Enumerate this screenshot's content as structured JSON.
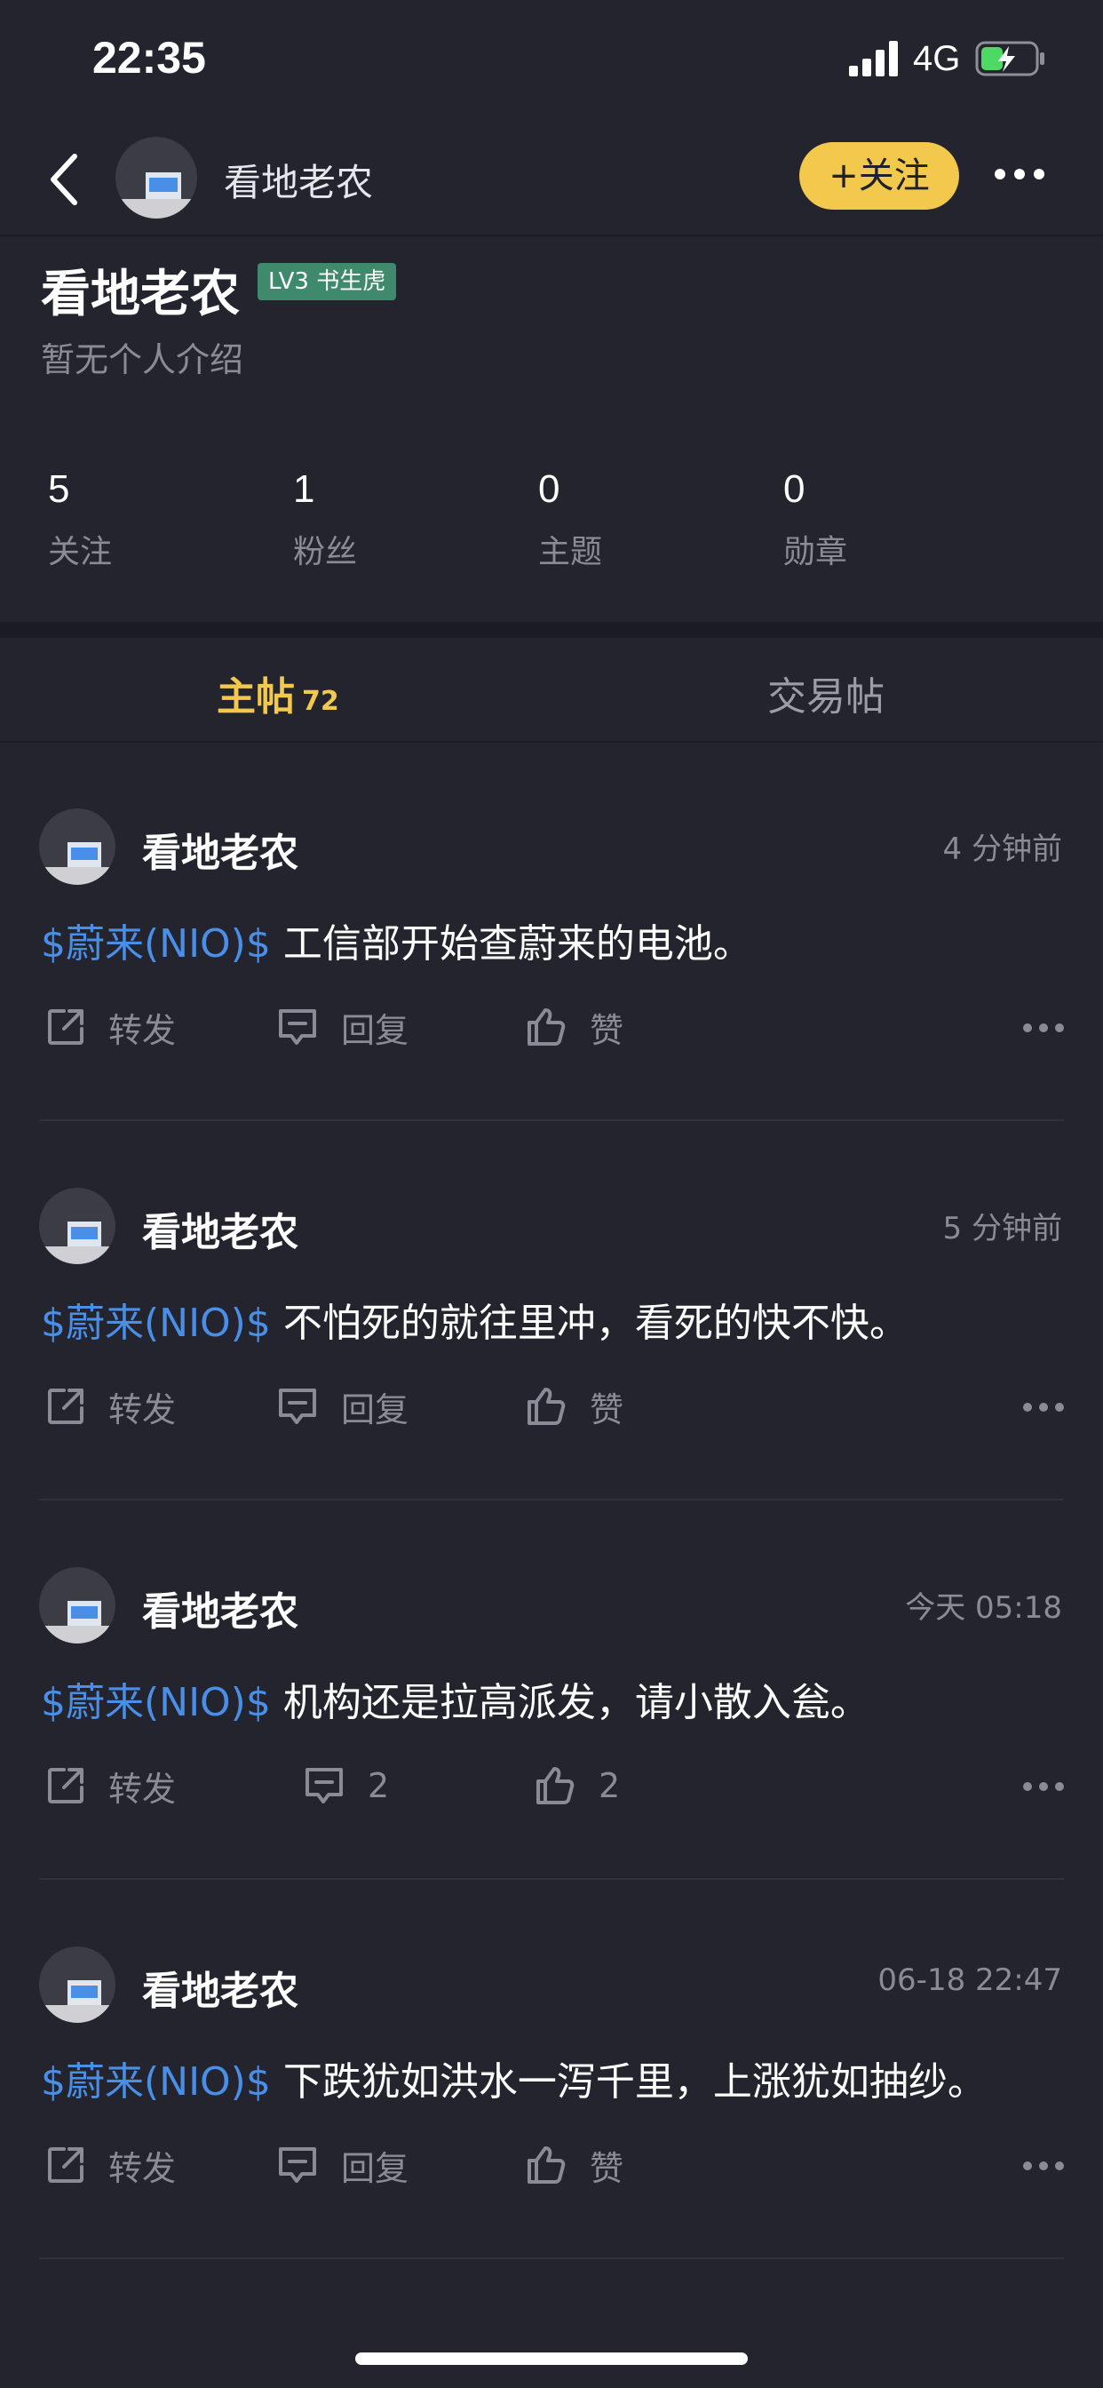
{
  "status_bar": {
    "time": "22:35",
    "network": "4G",
    "signal_icon": "signal-bars-icon",
    "battery_icon": "battery-charging-icon"
  },
  "nav": {
    "back_icon": "chevron-left-icon",
    "user_name": "看地老农",
    "follow_label": "+关注",
    "more_icon": "ellipsis-icon"
  },
  "profile": {
    "name": "看地老农",
    "level_badge": "LV3 书生虎",
    "bio": "暂无个人介绍",
    "stats": [
      {
        "value": "5",
        "label": "关注"
      },
      {
        "value": "1",
        "label": "粉丝"
      },
      {
        "value": "0",
        "label": "主题"
      },
      {
        "value": "0",
        "label": "勋章"
      }
    ]
  },
  "tabs": {
    "main_label": "主帖",
    "main_count": "72",
    "trade_label": "交易帖"
  },
  "posts": [
    {
      "author": "看地老农",
      "time": "4 分钟前",
      "stock_tag": "$蔚来(NIO)$",
      "text": "工信部开始查蔚来的电池。",
      "forward_label": "转发",
      "reply_label": "回复",
      "like_label": "赞"
    },
    {
      "author": "看地老农",
      "time": "5 分钟前",
      "stock_tag": "$蔚来(NIO)$",
      "text": "不怕死的就往里冲，看死的快不快。",
      "forward_label": "转发",
      "reply_label": "回复",
      "like_label": "赞"
    },
    {
      "author": "看地老农",
      "time": "今天 05:18",
      "stock_tag": "$蔚来(NIO)$",
      "text": "机构还是拉高派发，请小散入瓮。",
      "forward_label": "转发",
      "reply_label": "2",
      "like_label": "2"
    },
    {
      "author": "看地老农",
      "time": "06-18 22:47",
      "stock_tag": "$蔚来(NIO)$",
      "text": "下跌犹如洪水一泻千里，上涨犹如抽纱。",
      "forward_label": "转发",
      "reply_label": "回复",
      "like_label": "赞"
    }
  ],
  "colors": {
    "background": "#23242d",
    "accent_yellow": "#f2c94c",
    "stock_blue": "#4a8fe7",
    "badge_green": "#3f8a6c",
    "muted_text": "#8a8b96"
  }
}
